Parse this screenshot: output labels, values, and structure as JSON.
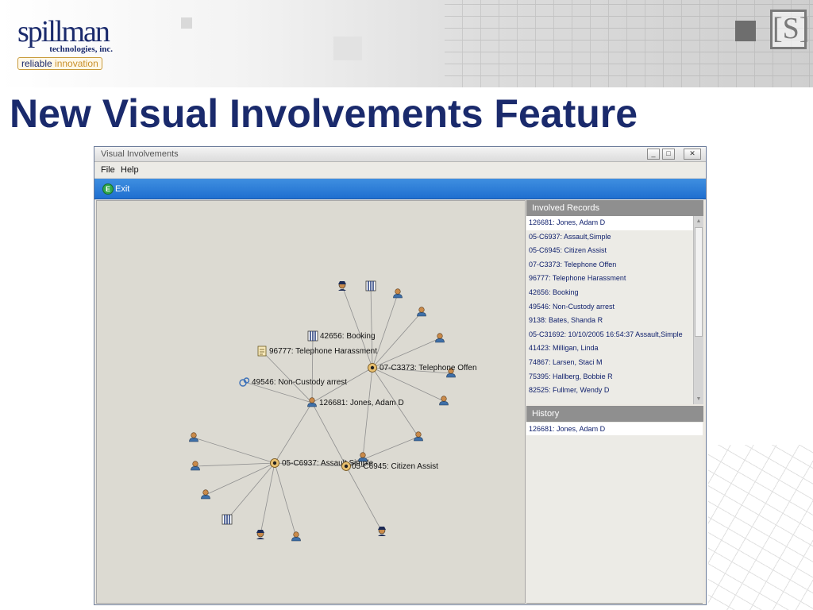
{
  "slide": {
    "logo_word": "spillman",
    "logo_sub": "technologies, inc.",
    "logo_tag_a": "reliable",
    "logo_tag_b": " innovation",
    "badge": "[S]",
    "title": "New Visual Involvements Feature"
  },
  "window": {
    "title": "Visual Involvements",
    "buttons": {
      "minimize": "_",
      "maximize": "□",
      "close": "✕"
    },
    "menu": {
      "file": "File",
      "help": "Help"
    },
    "toolbar": {
      "exit_label": "Exit",
      "exit_icon": "E"
    }
  },
  "graph": {
    "labels": {
      "booking": "42656: Booking",
      "telephone_harassment": "96777: Telephone Harassment",
      "telephone_offen": "07-C3373: Telephone Offen",
      "non_custody": "49546: Non-Custody arrest",
      "jones": "126681: Jones, Adam D",
      "assault": "05-C6937: Assault,Simple",
      "citizen_assist": "05-C6945: Citizen Assist"
    },
    "icons": {
      "person": "person-icon",
      "incident": "incident-icon",
      "jail": "jail-icon",
      "document": "document-icon",
      "arrest": "arrest-icon"
    }
  },
  "involved_records": {
    "header": "Involved Records",
    "items": [
      "126681: Jones, Adam D",
      "05-C6937: Assault,Simple",
      "05-C6945: Citizen Assist",
      "07-C3373: Telephone Offen",
      "96777: Telephone Harassment",
      "42656: Booking",
      "49546: Non-Custody arrest",
      "9138: Bates, Shanda R",
      "05-C31692: 10/10/2005 16:54:37 Assault,Simple",
      "41423: Milligan, Linda",
      "74867: Larsen, Staci M",
      "75395: Hallberg, Bobbie R",
      "82525: Fullmer, Wendy D"
    ]
  },
  "history": {
    "header": "History",
    "items": [
      "126681: Jones, Adam D"
    ]
  },
  "colors": {
    "title_blue": "#1a2a6c",
    "toolbar_blue": "#2a7ad8",
    "list_text": "#0d1e6b"
  }
}
